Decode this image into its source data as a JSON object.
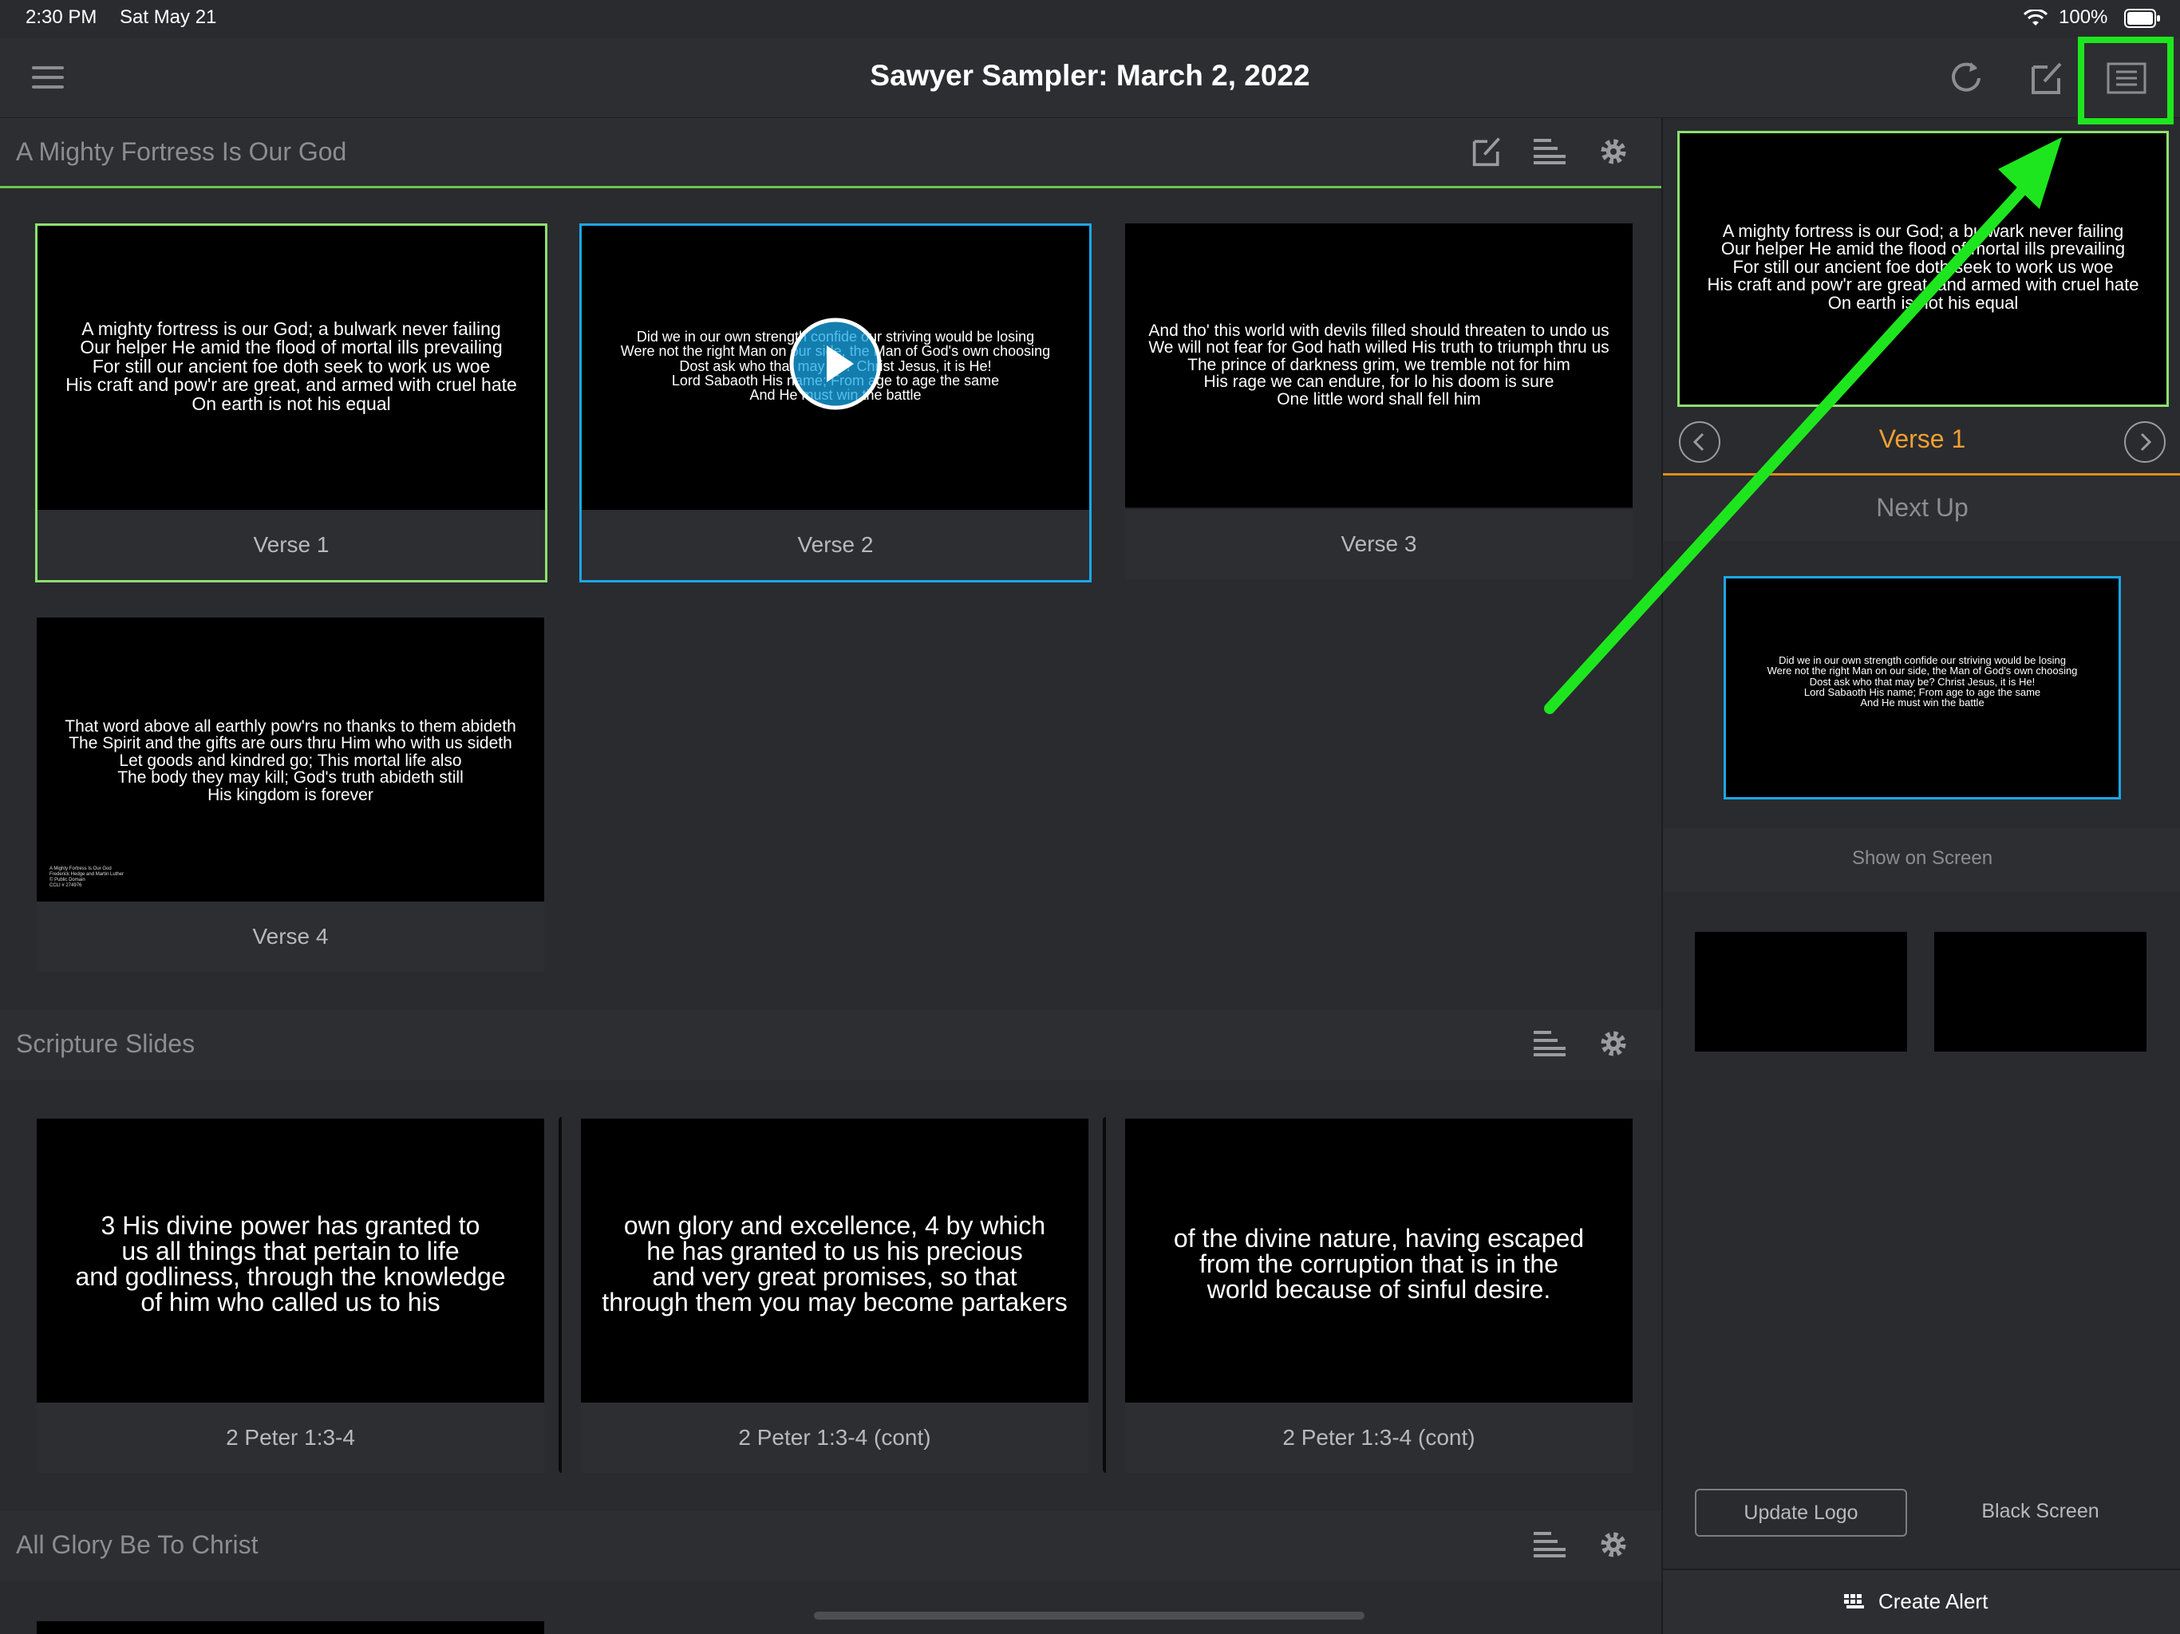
{
  "status_bar": {
    "time": "2:30 PM",
    "date": "Sat May 21",
    "battery": "100%"
  },
  "navbar": {
    "title": "Sawyer Sampler: March 2, 2022",
    "menu_icon": "hamburger-menu-icon",
    "refresh_icon": "refresh-icon",
    "edit_icon": "edit-icon",
    "present_icon": "screen-output-icon"
  },
  "sections": [
    {
      "title": "A Mighty Fortress Is Our God",
      "slides": [
        {
          "label": "Verse 1",
          "lines": [
            "A mighty fortress is our God; a bulwark never failing",
            "Our helper He amid the flood of mortal ills prevailing",
            "For still our ancient foe doth seek to work us woe",
            "His craft and pow'r are great, and armed with cruel hate",
            "On earth is not his equal"
          ]
        },
        {
          "label": "Verse 2",
          "lines": [
            "Did we in our own strength confide our striving would be losing",
            "Were not the right Man on our side, the Man of God's own choosing",
            "Dost ask who that may be? Christ Jesus, it is He!",
            "Lord Sabaoth His name; From age to age the same",
            "And He must win the battle"
          ]
        },
        {
          "label": "Verse 3",
          "lines": [
            "And tho' this world with devils filled should threaten to undo us",
            "We will not fear for God hath willed His truth to triumph thru us",
            "The prince of darkness grim, we tremble not for him",
            "His rage we can endure, for lo his doom is sure",
            "One little word shall fell him"
          ]
        },
        {
          "label": "Verse 4",
          "lines": [
            "That word above all earthly pow'rs no thanks to them abideth",
            "The Spirit and the gifts are ours thru Him who with us sideth",
            "Let goods and kindred go; This mortal life also",
            "The body they may kill; God's truth abideth still",
            "His kingdom is forever"
          ],
          "credits": [
            "A Mighty Fortress Is Our God",
            "Frederick Hedge and Martin Luther",
            "© Public Domain",
            "CCLI # 274976"
          ]
        }
      ]
    },
    {
      "title": "Scripture Slides",
      "slides": [
        {
          "label": "2 Peter 1:3-4",
          "lines": [
            "3 His divine power has granted to",
            "us all things that pertain to life",
            "and godliness, through the knowledge",
            "of him who called us to his"
          ]
        },
        {
          "label": "2 Peter 1:3-4 (cont)",
          "lines": [
            "own glory and excellence, 4 by which",
            "he has granted to us his precious",
            "and very great promises, so that",
            "through them you may become partakers"
          ]
        },
        {
          "label": "2 Peter 1:3-4 (cont)",
          "lines": [
            "of the divine nature, having escaped",
            "from the corruption that is in the",
            "world because of sinful desire."
          ]
        }
      ]
    },
    {
      "title": "All Glory Be To Christ"
    }
  ],
  "right_panel": {
    "live_lines": [
      "A mighty fortress is our God; a bulwark never failing",
      "Our helper He amid the flood of mortal ills prevailing",
      "For still our ancient foe doth seek to work us woe",
      "His craft and pow'r are great, and armed with cruel hate",
      "On earth is not his equal"
    ],
    "current_label": "Verse 1",
    "next_up_title": "Next Up",
    "next_lines": [
      "Did we in our own strength confide our striving would be losing",
      "Were not the right Man on our side, the Man of God's own choosing",
      "Dost ask who that may be? Christ Jesus, it is He!",
      "Lord Sabaoth His name; From age to age the same",
      "And He must win the battle"
    ],
    "show_on_screen": "Show on Screen",
    "update_logo": "Update Logo",
    "black_screen": "Black Screen",
    "create_alert": "Create Alert"
  },
  "colors": {
    "live": "#8ee06e",
    "next": "#1aa8e8",
    "accent": "#f0a030",
    "annotation": "#1ee61e"
  }
}
